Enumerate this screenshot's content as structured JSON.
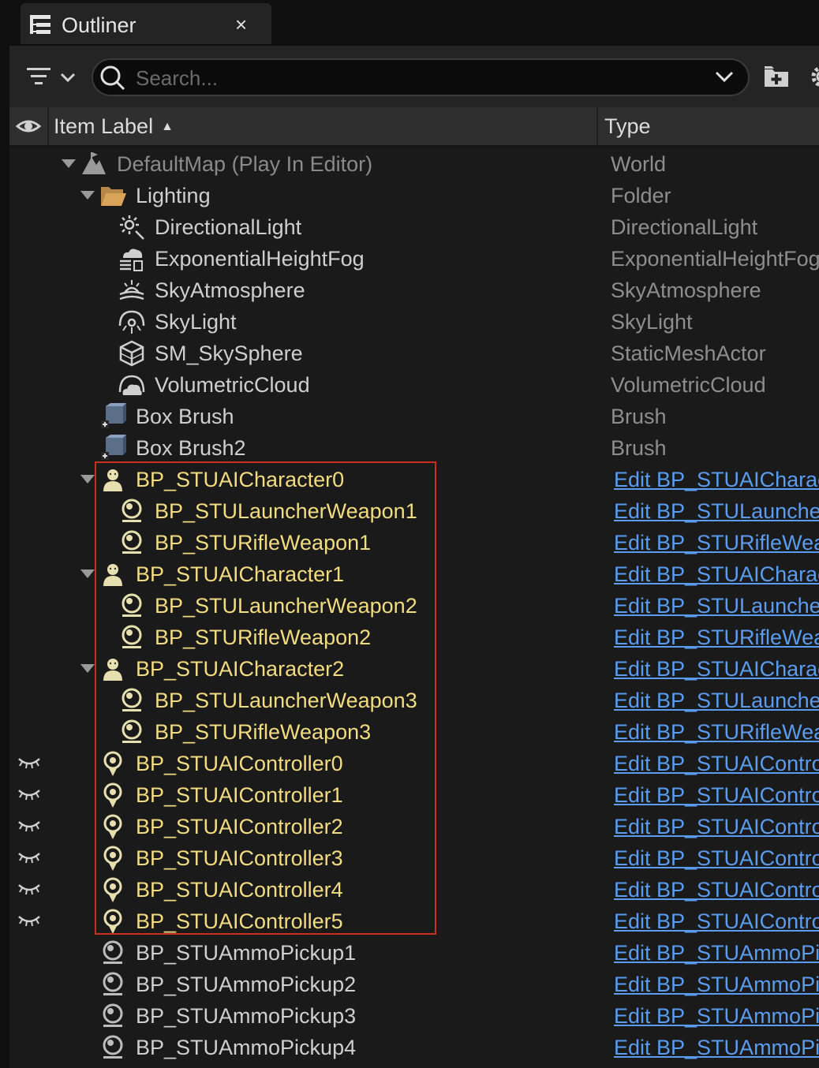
{
  "tab": {
    "title": "Outliner",
    "close_glyph": "×"
  },
  "toolbar": {
    "search_placeholder": "Search...",
    "icons": [
      "filter-icon",
      "search-icon",
      "chevron-down-icon",
      "add-folder-icon",
      "gear-icon"
    ]
  },
  "header": {
    "item_label": "Item Label",
    "sort_glyph": "▲",
    "type": "Type"
  },
  "colors": {
    "actor_label": "#f2dc82",
    "link": "#5a9cf0",
    "highlight_border": "#c8301e",
    "type_text": "#8e8e8e"
  },
  "rows": [
    {
      "label": "DefaultMap (Play In Editor)",
      "type": "World"
    },
    {
      "label": "Lighting",
      "type": "Folder"
    },
    {
      "label": "DirectionalLight",
      "type": "DirectionalLight"
    },
    {
      "label": "ExponentialHeightFog",
      "type": "ExponentialHeightFog"
    },
    {
      "label": "SkyAtmosphere",
      "type": "SkyAtmosphere"
    },
    {
      "label": "SkyLight",
      "type": "SkyLight"
    },
    {
      "label": "SM_SkySphere",
      "type": "StaticMeshActor"
    },
    {
      "label": "VolumetricCloud",
      "type": "VolumetricCloud"
    },
    {
      "label": "Box Brush",
      "type": "Brush"
    },
    {
      "label": "Box Brush2",
      "type": "Brush"
    },
    {
      "label": "BP_STUAICharacter0",
      "type": "Edit BP_STUAICharac"
    },
    {
      "label": "BP_STULauncherWeapon1",
      "type": "Edit BP_STULauncher"
    },
    {
      "label": "BP_STURifleWeapon1",
      "type": "Edit BP_STURifleWea"
    },
    {
      "label": "BP_STUAICharacter1",
      "type": "Edit BP_STUAICharac"
    },
    {
      "label": "BP_STULauncherWeapon2",
      "type": "Edit BP_STULauncher"
    },
    {
      "label": "BP_STURifleWeapon2",
      "type": "Edit BP_STURifleWea"
    },
    {
      "label": "BP_STUAICharacter2",
      "type": "Edit BP_STUAICharac"
    },
    {
      "label": "BP_STULauncherWeapon3",
      "type": "Edit BP_STULauncher"
    },
    {
      "label": "BP_STURifleWeapon3",
      "type": "Edit BP_STURifleWea"
    },
    {
      "label": "BP_STUAIController0",
      "type": "Edit BP_STUAIControl"
    },
    {
      "label": "BP_STUAIController1",
      "type": "Edit BP_STUAIControl"
    },
    {
      "label": "BP_STUAIController2",
      "type": "Edit BP_STUAIControl"
    },
    {
      "label": "BP_STUAIController3",
      "type": "Edit BP_STUAIControl"
    },
    {
      "label": "BP_STUAIController4",
      "type": "Edit BP_STUAIControl"
    },
    {
      "label": "BP_STUAIController5",
      "type": "Edit BP_STUAIControl"
    },
    {
      "label": "BP_STUAmmoPickup1",
      "type": "Edit BP_STUAmmoPic"
    },
    {
      "label": "BP_STUAmmoPickup2",
      "type": "Edit BP_STUAmmoPic"
    },
    {
      "label": "BP_STUAmmoPickup3",
      "type": "Edit BP_STUAmmoPic"
    },
    {
      "label": "BP_STUAmmoPickup4",
      "type": "Edit BP_STUAmmoPic"
    }
  ]
}
